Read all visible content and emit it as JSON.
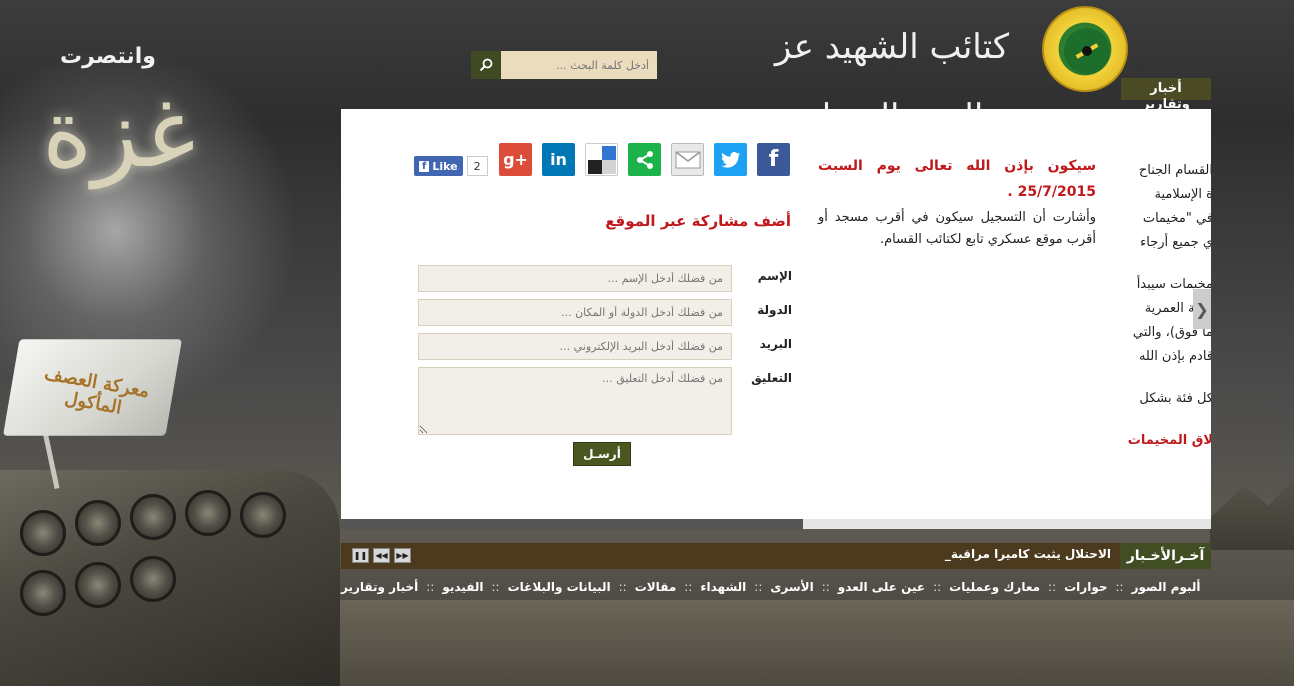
{
  "header": {
    "slogan": "وانتصرت",
    "gaza_art": "غزة",
    "brand_title": "كتائب الشهيد عز الدين القسام",
    "search": {
      "placeholder": "أدخل كلمة البحث ..."
    },
    "reports_tab": "أخبار وتقارير"
  },
  "background": {
    "flag_text": "معركة العصف المأكول"
  },
  "article": {
    "lead": "سيكون بإذن الله تعالى يوم السبت 25/7/2015 .",
    "body": "وأشارت أن التسجيل سيكون في أقرب مسجد أو أقرب موقع عسكري تابع لكتائب القسام."
  },
  "side_article": {
    "lines_1": [
      "القسام الجناح",
      "ة الإسلامية",
      "في \"مخيمات",
      "ي جميع أرجاء"
    ],
    "lines_2": [
      "مخيمات سيبدأ",
      "الفئة العمرية",
      "ما فوق)، والتي",
      "قادم بإذن الله"
    ],
    "lines_3": [
      "كل فئة بشكل"
    ],
    "red_line": "لاق المخيمات"
  },
  "share": {
    "like_label": "Like",
    "like_count": "2",
    "icons": [
      "facebook-icon",
      "twitter-icon",
      "email-icon",
      "share-icon",
      "delicious-icon",
      "linkedin-icon",
      "google-plus-icon"
    ]
  },
  "form": {
    "title": "أضف مشاركة عبر الموقع",
    "name_label": "الإسم",
    "name_placeholder": "من فضلك أدخل الإسم ...",
    "country_label": "الدولة",
    "country_placeholder": "من فضلك أدخل الدولة أو المكان ...",
    "email_label": "البريد",
    "email_placeholder": "من فضلك أدخل البريد الإلكتروني ...",
    "comment_label": "التعليق",
    "comment_placeholder": "من فضلك أدخل التعليق ...",
    "submit": "أرسـل"
  },
  "ticker": {
    "label": "آخـرالأخـبار",
    "text": "الاحتلال يثبت كاميرا مراقبة_"
  },
  "nav": {
    "items": [
      "أخبار وتقارير",
      "الفيديو",
      "البيانات والبلاغات",
      "مقالات",
      "الشهداء",
      "الأسرى",
      "عين على العدو",
      "معارك وعمليات",
      "حوارات",
      "ألبوم الصور"
    ],
    "separator": "::"
  },
  "colors": {
    "accent_red": "#c0181b",
    "olive": "#4a5720",
    "ticker_bg": "#4b3a1e"
  }
}
